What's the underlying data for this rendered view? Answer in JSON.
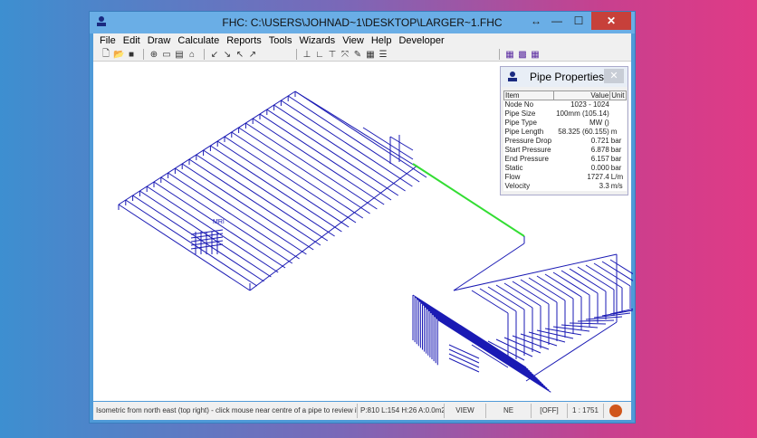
{
  "window": {
    "title": "FHC: C:\\USERS\\JOHNAD~1\\DESKTOP\\LARGER~1.FHC",
    "minimize": "—",
    "maximize": "☐",
    "close": "✕",
    "restore_extra": "↔"
  },
  "menu": [
    "File",
    "Edit",
    "Draw",
    "Calculate",
    "Reports",
    "Tools",
    "Wizards",
    "View",
    "Help",
    "Developer"
  ],
  "toolbar": {
    "groups": [
      [
        "new-icon",
        "open-icon",
        "save-icon"
      ],
      [
        "zoom-icon",
        "rect-icon",
        "window-icon",
        "shape-icon"
      ],
      [
        "arrow-sw-icon",
        "arrow-se-icon",
        "arrow-nw-icon",
        "arrow-ne-icon"
      ],
      [
        "node-icon",
        "elbow-icon",
        "tee-icon",
        "branch-icon",
        "edit-icon",
        "report-icon",
        "list-icon"
      ],
      [
        "grid-icon",
        "grid2-icon",
        "grid3-icon"
      ]
    ]
  },
  "canvas": {
    "label": "MRI",
    "pipe_color": "#1a1ab4",
    "selected_color": "#33dd33"
  },
  "pipe_properties": {
    "title": "Pipe Properties",
    "close": "✕",
    "columns": [
      "Item",
      "Value",
      "Unit"
    ],
    "rows": [
      [
        "Node No",
        "1023 - 1024",
        ""
      ],
      [
        "Pipe Size",
        "100mm (105.14)",
        ""
      ],
      [
        "Pipe Type",
        "MW ()",
        ""
      ],
      [
        "Pipe Length",
        "58.325 (60.155)",
        "m"
      ],
      [
        "Pressure Drop",
        "0.721",
        "bar"
      ],
      [
        "Start Pressure",
        "6.878",
        "bar"
      ],
      [
        "End Pressure",
        "6.157",
        "bar"
      ],
      [
        "Static",
        "0.000",
        "bar"
      ],
      [
        "Flow",
        "1727.4",
        "L/m"
      ],
      [
        "Velocity",
        "3.3",
        "m/s"
      ]
    ]
  },
  "status": {
    "message": "Isometric from north east (top right) - click mouse near centre of a pipe to review its i",
    "info": "P:810 L:154 H:26 A:0.0m2",
    "mode": "VIEW",
    "direction": "NE",
    "state": "[OFF]",
    "scale": "1 : 1751"
  }
}
